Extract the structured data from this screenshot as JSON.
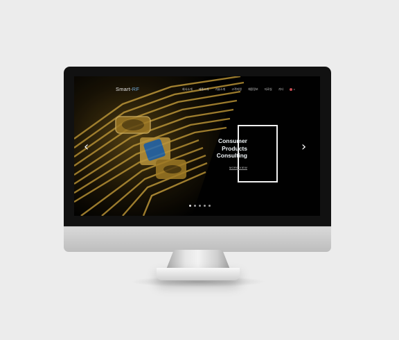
{
  "site": {
    "logo_prefix": "Smart-",
    "logo_suffix": "RF"
  },
  "nav": {
    "items": [
      "회사소개",
      "제품소개",
      "기술소개",
      "고객지원",
      "채용정보",
      "자료실",
      "기타"
    ],
    "language_icon": "flag-icon"
  },
  "hero": {
    "headline_lines": [
      "Consumer",
      "Products",
      "Consulting"
    ],
    "more_label": "MORE VIEW",
    "prev_arrow": "‹",
    "next_arrow": "›",
    "slide_count": 5,
    "active_slide": 1
  },
  "colors": {
    "accent_blue": "#6fa9d8",
    "gold": "#c9a13b",
    "chip_blue": "#2a78c9",
    "background": "#ececec"
  }
}
